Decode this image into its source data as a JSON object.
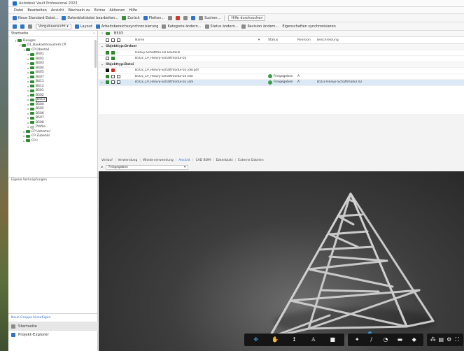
{
  "app": {
    "title": "Autodesk Vault Professional 2023"
  },
  "menu": [
    "Datei",
    "Bearbeiten",
    "Ansicht",
    "Wechseln zu",
    "Extras",
    "Aktionen",
    "Hilfe"
  ],
  "toolbar": {
    "new_std": "Neue Standard-Datei...",
    "edit_datasheet": "Datenblattdatei bearbeiten...",
    "refresh": "Zurück",
    "plot": "Plotten...",
    "search": "Suchen...",
    "search_placeholder": "Hilfe durchsuchen",
    "view_select": "Vorgabeansicht",
    "layout": "Layout",
    "workspace_sync": "Arbeitsbereichssynchronisierung",
    "change_category": "Kategorie ändern...",
    "change_status": "Status ändern...",
    "change_revision": "Revision ändern...",
    "sync_props": "Eigenschaften synchronisieren"
  },
  "left": {
    "header": "Startseite",
    "tree": [
      {
        "label": "Designs",
        "level": 0,
        "expanded": true
      },
      {
        "label": "01_Baukastensystem CP",
        "level": 1,
        "expanded": true
      },
      {
        "label": "CP Oberteil",
        "level": 2,
        "expanded": true
      },
      {
        "label": "B401",
        "level": 3
      },
      {
        "label": "B402",
        "level": 3
      },
      {
        "label": "B403",
        "level": 3
      },
      {
        "label": "B404",
        "level": 3
      },
      {
        "label": "B405",
        "level": 3
      },
      {
        "label": "B407",
        "level": 3
      },
      {
        "label": "B411",
        "level": 3
      },
      {
        "label": "B412",
        "level": 3
      },
      {
        "label": "B501",
        "level": 3
      },
      {
        "label": "B502",
        "level": 3
      },
      {
        "label": "B503",
        "level": 3,
        "selected": true
      },
      {
        "label": "B504",
        "level": 3
      },
      {
        "label": "B505",
        "level": 3
      },
      {
        "label": "B506",
        "level": 3
      },
      {
        "label": "B507",
        "level": 3
      },
      {
        "label": "B508",
        "level": 3
      },
      {
        "label": "Profile",
        "level": 3,
        "light": true
      },
      {
        "label": "CP Unterteil",
        "level": 2
      },
      {
        "label": "CP Zubehör",
        "level": 2
      },
      {
        "label": "CP-I",
        "level": 2
      }
    ],
    "sub_header": "Eigene Verknüpfungen",
    "bottom_link": "Neue Gruppe hinzufügen",
    "bottom_items": [
      "Startseite",
      "Projekt-Explorer"
    ]
  },
  "right": {
    "breadcrumb": "B503",
    "columns": {
      "name": "Name",
      "status": "Status",
      "revision": "Revision",
      "description": "Beschreibung"
    },
    "rows": [
      {
        "type": "group",
        "name": "Objekttyp:Ordner"
      },
      {
        "type": "item",
        "icons": [
          "green",
          "green"
        ],
        "name": "Heavy-Schaftmo-02 Bauteile",
        "status": "",
        "rev": "",
        "desc": ""
      },
      {
        "type": "item",
        "icons": [
          "outline",
          "green"
        ],
        "name": "B503_CP_Heavy-Schaftmodul-02",
        "status": "",
        "rev": "",
        "desc": ""
      },
      {
        "type": "group",
        "name": "Objekttyp:Datei"
      },
      {
        "type": "item",
        "icons": [
          "black",
          "red"
        ],
        "name": "B503_CP_Heavy-Schaftmodul-02.idw.pdf",
        "status": "",
        "rev": "",
        "desc": ""
      },
      {
        "type": "item",
        "icons": [
          "green",
          "outline",
          "outline"
        ],
        "name": "B503_CP_Heavy-Schaftmodul-02.idw",
        "status": "Freigegeben",
        "rev": "A",
        "desc": ""
      },
      {
        "type": "item",
        "icons": [
          "green",
          "outline",
          "outline"
        ],
        "name": "B503_CP_Heavy-Schaftmodul-02.iam",
        "status": "Freigegeben",
        "rev": "A",
        "desc": "B503 Heavy-Schaftmodul 02",
        "selected": true
      }
    ],
    "tabs": [
      "Verlauf",
      "Verwendung",
      "Wiederverwendung",
      "Ansicht",
      "CAD BOM",
      "Datenblatt",
      "Externe Dateien"
    ],
    "active_tab": "Ansicht",
    "filter_value": "Freigegeben"
  },
  "viewer": {
    "bar1": [
      "orbit-icon",
      "hand-icon",
      "zoom-icon",
      "walk-icon",
      "camera-icon"
    ],
    "bar2": [
      "explode-icon",
      "measure-icon",
      "markup-icon",
      "section-icon",
      "model-icon"
    ],
    "bar3": [
      "structure-icon",
      "properties-icon",
      "settings-icon",
      "fullscreen-icon"
    ],
    "colors": {
      "accent": "#3a9ad9",
      "steel": "#c9c9c9"
    }
  }
}
